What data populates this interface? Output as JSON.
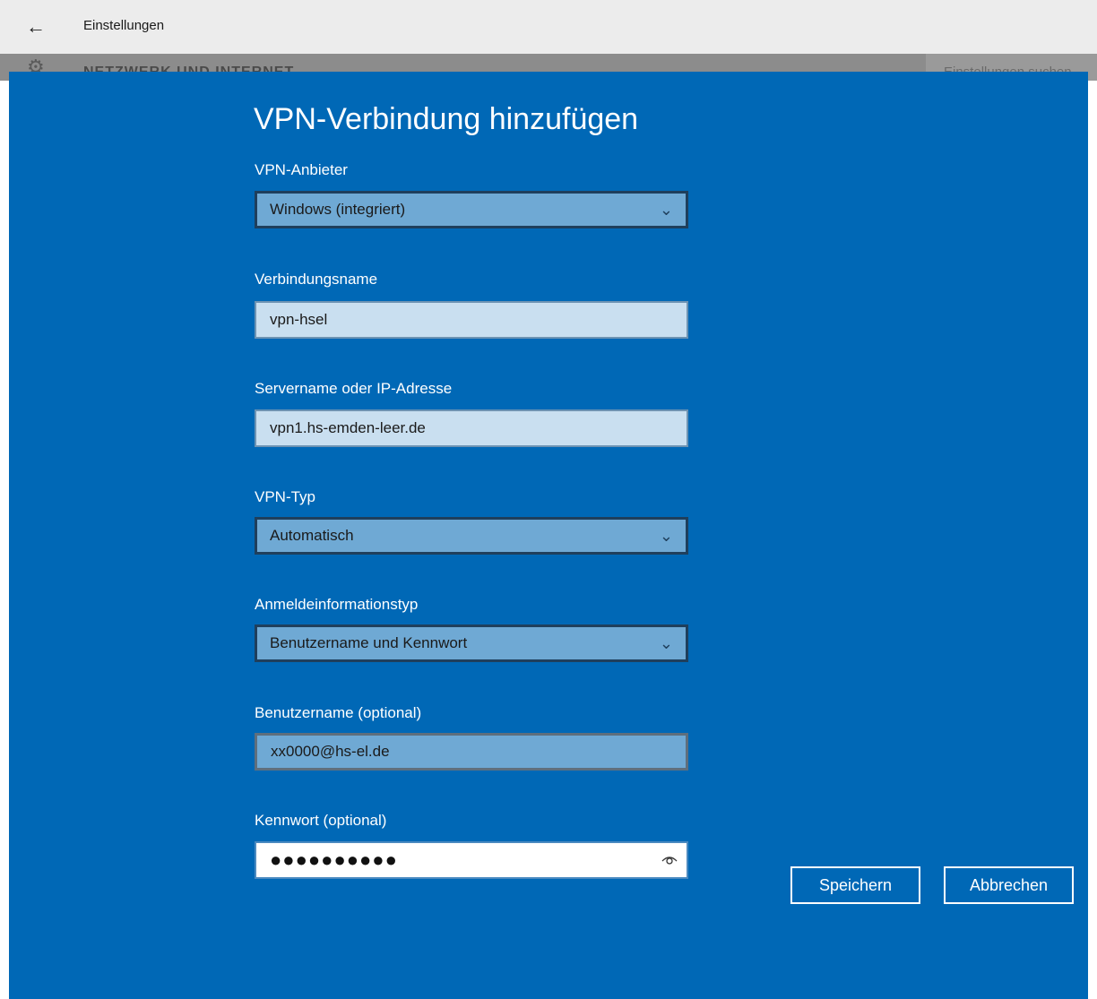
{
  "titlebar": {
    "back_icon": "back-arrow-icon",
    "title": "Einstellungen"
  },
  "background_page": {
    "heading": "NETZWERK UND INTERNET",
    "side_text": "Einstellungen suchen"
  },
  "dialog": {
    "title": "VPN-Verbindung hinzufügen",
    "provider": {
      "label": "VPN-Anbieter",
      "value": "Windows (integriert)"
    },
    "connection_name": {
      "label": "Verbindungsname",
      "value": "vpn-hsel"
    },
    "server": {
      "label": "Servername oder IP-Adresse",
      "value": "vpn1.hs-emden-leer.de"
    },
    "vpn_type": {
      "label": "VPN-Typ",
      "value": "Automatisch"
    },
    "sign_in_type": {
      "label": "Anmeldeinformationstyp",
      "value": "Benutzername und Kennwort"
    },
    "username": {
      "label": "Benutzername (optional)",
      "value": "xx0000@hs-el.de"
    },
    "password": {
      "label": "Kennwort (optional)",
      "value": "●●●●●●●●●●",
      "reveal_icon": "eye-icon"
    },
    "save_label": "Speichern",
    "cancel_label": "Abbrechen"
  },
  "colors": {
    "dialog_bg": "#0068b6",
    "combo_bg": "#6fa9d4",
    "textbox_bg": "#c9dff0"
  }
}
